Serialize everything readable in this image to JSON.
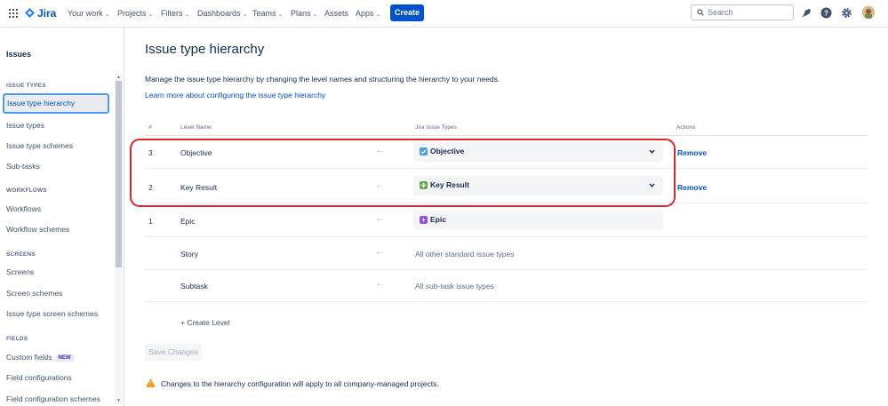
{
  "nav": {
    "logo_text": "Jira",
    "items": [
      "Your work",
      "Projects",
      "Filters",
      "Dashboards",
      "Teams",
      "Plans",
      "Assets",
      "Apps"
    ],
    "create_label": "Create",
    "search_placeholder": "Search"
  },
  "sidebar": {
    "title": "Issues",
    "sections": {
      "issue_types": "ISSUE TYPES",
      "workflows": "WORKFLOWS",
      "screens": "SCREENS",
      "fields": "FIELDS"
    },
    "items": {
      "issue_type_hierarchy": "Issue type hierarchy",
      "issue_types": "Issue types",
      "issue_type_schemes": "Issue type schemes",
      "sub_tasks": "Sub-tasks",
      "workflows": "Workflows",
      "workflow_schemes": "Workflow schemes",
      "screens": "Screens",
      "screen_schemes": "Screen schemes",
      "issue_type_screen_schemes": "Issue type screen schemes",
      "custom_fields": "Custom fields",
      "field_configurations": "Field configurations",
      "field_configuration_schemes": "Field configuration schemes"
    },
    "new_badge": "NEW"
  },
  "main": {
    "title": "Issue type hierarchy",
    "description": "Manage the issue type hierarchy by changing the level names and structuring the hierarchy to your needs.",
    "learn_more": "Learn more about configuring the issue type hierarchy",
    "columns": {
      "num": "#",
      "level_name": "Level Name",
      "issue_types": "Jira Issue Types",
      "actions": "Actions"
    },
    "rows": [
      {
        "num": "3",
        "name": "Objective",
        "type": "Objective",
        "action": "Remove"
      },
      {
        "num": "2",
        "name": "Key Result",
        "type": "Key Result",
        "action": "Remove"
      },
      {
        "num": "1",
        "name": "Epic",
        "type": "Epic"
      },
      {
        "num": "",
        "name": "Story",
        "type_text": "All other standard issue types"
      },
      {
        "num": "",
        "name": "Subtask",
        "type_text": "All sub-task issue types"
      }
    ],
    "create_level": "Create Level",
    "save_changes": "Save Changes",
    "warning": "Changes to the hierarchy configuration will apply to all company-managed projects."
  },
  "colors": {
    "brand": "#0052cc",
    "highlight": "#e3262c",
    "objective_icon": "#4b9fe1",
    "key_result_icon": "#5aac44",
    "epic_icon": "#904ee2",
    "warning": "#ff8b00"
  }
}
